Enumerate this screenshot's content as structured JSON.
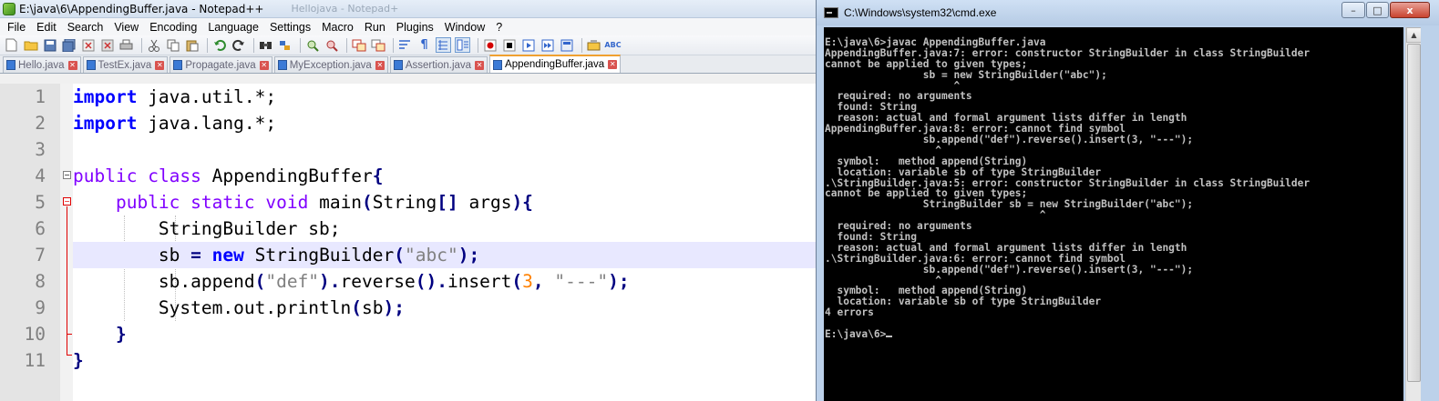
{
  "npp": {
    "title": "E:\\java\\6\\AppendingBuffer.java - Notepad++",
    "ghost_title": "Hellojava - Notepad+",
    "menu": [
      "File",
      "Edit",
      "Search",
      "View",
      "Encoding",
      "Language",
      "Settings",
      "Macro",
      "Run",
      "Plugins",
      "Window",
      "?"
    ],
    "tabs": [
      {
        "label": "Hello.java",
        "active": false
      },
      {
        "label": "TestEx.java",
        "active": false
      },
      {
        "label": "Propagate.java",
        "active": false
      },
      {
        "label": "MyException.java",
        "active": false
      },
      {
        "label": "Assertion.java",
        "active": false
      },
      {
        "label": "AppendingBuffer.java",
        "active": true
      }
    ],
    "line_numbers": [
      "1",
      "2",
      "3",
      "4",
      "5",
      "6",
      "7",
      "8",
      "9",
      "10",
      "11"
    ],
    "code": {
      "l1_kw": "import",
      "l1_rest": " java.util.*;",
      "l2_kw": "import",
      "l2_rest": " java.lang.*;",
      "l4_kw1": "public",
      "l4_kw2": "class",
      "l4_name": " AppendingBuffer",
      "l4_brace": "{",
      "l5_kw1": "public",
      "l5_kw2": "static",
      "l5_kw3": "void",
      "l5_mid": " main",
      "l5_p1": "(",
      "l5_type": "String",
      "l5_brk": "[]",
      "l5_arg": " args",
      "l5_p2": "){",
      "l6": "StringBuilder sb;",
      "l7_a": "sb ",
      "l7_eq": "=",
      "l7_kw": "new",
      "l7_b": " StringBuilder",
      "l7_p1": "(",
      "l7_str": "\"abc\"",
      "l7_p2": ");",
      "l8_a": "sb.append",
      "l8_p1": "(",
      "l8_str1": "\"def\"",
      "l8_p2": ").",
      "l8_b": "reverse",
      "l8_p3": "().",
      "l8_c": "insert",
      "l8_p4": "(",
      "l8_num": "3",
      "l8_comma": ",",
      "l8_str2": " \"---\"",
      "l8_p5": ");",
      "l9_a": "System.out.println",
      "l9_p1": "(",
      "l9_b": "sb",
      "l9_p2": ");",
      "l10": "}",
      "l11": "}"
    }
  },
  "cmd": {
    "title": "C:\\Windows\\system32\\cmd.exe",
    "lines": [
      "E:\\java\\6>javac AppendingBuffer.java",
      "AppendingBuffer.java:7: error: constructor StringBuilder in class StringBuilder",
      "cannot be applied to given types;",
      "                sb = new StringBuilder(\"abc\");",
      "                     ^",
      "  required: no arguments",
      "  found: String",
      "  reason: actual and formal argument lists differ in length",
      "AppendingBuffer.java:8: error: cannot find symbol",
      "                sb.append(\"def\").reverse().insert(3, \"---\");",
      "                  ^",
      "  symbol:   method append(String)",
      "  location: variable sb of type StringBuilder",
      ".\\StringBuilder.java:5: error: constructor StringBuilder in class StringBuilder",
      "cannot be applied to given types;",
      "                StringBuilder sb = new StringBuilder(\"abc\");",
      "                                   ^",
      "  required: no arguments",
      "  found: String",
      "  reason: actual and formal argument lists differ in length",
      ".\\StringBuilder.java:6: error: cannot find symbol",
      "                sb.append(\"def\").reverse().insert(3, \"---\");",
      "                  ^",
      "  symbol:   method append(String)",
      "  location: variable sb of type StringBuilder",
      "4 errors",
      "",
      "E:\\java\\6>"
    ],
    "buttons": {
      "min": "–",
      "max": "□",
      "close": "x"
    }
  }
}
